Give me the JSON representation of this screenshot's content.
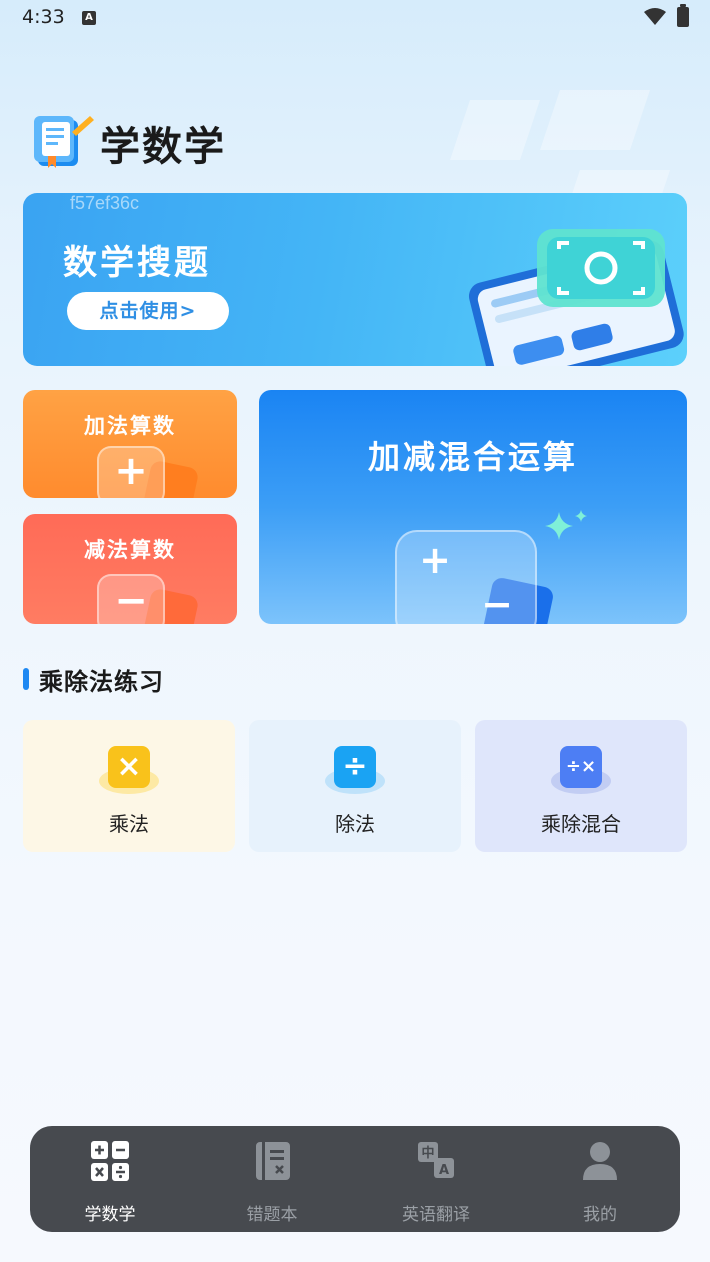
{
  "status_bar": {
    "time": "4:33",
    "notification_icon": "A"
  },
  "header": {
    "title": "学数学",
    "logo_icon": "notebook-pencil-icon"
  },
  "banner": {
    "code": "f57ef36c",
    "title": "数学搜题",
    "button_label": "点击使用>"
  },
  "cards": {
    "add": {
      "label": "加法算数",
      "symbol": "+"
    },
    "subtract": {
      "label": "减法算数",
      "symbol": "−"
    },
    "mixed": {
      "label": "加减混合运算",
      "symbol_plus": "+",
      "symbol_minus": "−"
    }
  },
  "section": {
    "title": "乘除法练习",
    "tiles": [
      {
        "label": "乘法",
        "symbol": "×",
        "color": "#f9c21b"
      },
      {
        "label": "除法",
        "symbol": "÷",
        "color": "#1aa3f3"
      },
      {
        "label": "乘除混合",
        "symbol": "÷×",
        "color": "#4d7ef4"
      }
    ]
  },
  "tabbar": {
    "accent": "#ffffff",
    "tabs": [
      {
        "label": "学数学",
        "icon": "calculator-icon",
        "active": true
      },
      {
        "label": "错题本",
        "icon": "notebook-icon",
        "active": false
      },
      {
        "label": "英语翻译",
        "icon": "translate-icon",
        "active": false
      },
      {
        "label": "我的",
        "icon": "user-icon",
        "active": false
      }
    ]
  }
}
